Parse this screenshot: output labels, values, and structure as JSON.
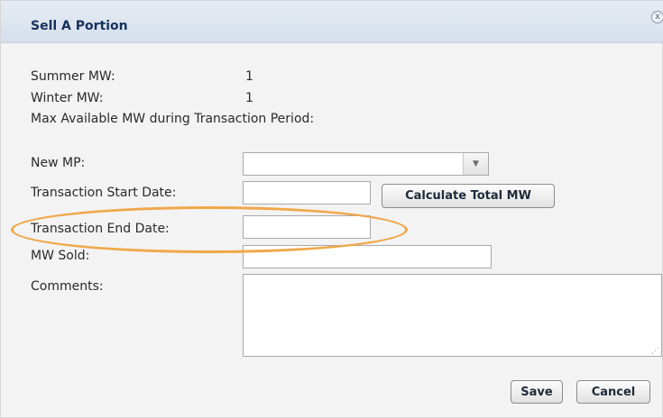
{
  "dialog": {
    "title": "Sell A Portion",
    "close_glyph": "x"
  },
  "info": {
    "summer_label": "Summer MW:",
    "summer_value": "1",
    "winter_label": "Winter MW:",
    "winter_value": "1",
    "max_available_label": "Max Available MW during Transaction Period:"
  },
  "form": {
    "new_mp_label": "New MP:",
    "new_mp_value": "",
    "start_date_label": "Transaction Start Date:",
    "start_date_value": "",
    "calculate_label": "Calculate Total MW",
    "end_date_label": "Transaction End Date:",
    "end_date_value": "",
    "mw_sold_label": "MW Sold:",
    "mw_sold_value": "",
    "comments_label": "Comments:",
    "comments_value": ""
  },
  "actions": {
    "save_label": "Save",
    "cancel_label": "Cancel"
  },
  "colors": {
    "title_text": "#16325c",
    "highlight": "#f0a84a",
    "panel_bg": "#f3f3f3"
  },
  "icons": {
    "close": "close-icon",
    "dropdown": "chevron-down-icon",
    "resize": "resize-grip-icon"
  }
}
